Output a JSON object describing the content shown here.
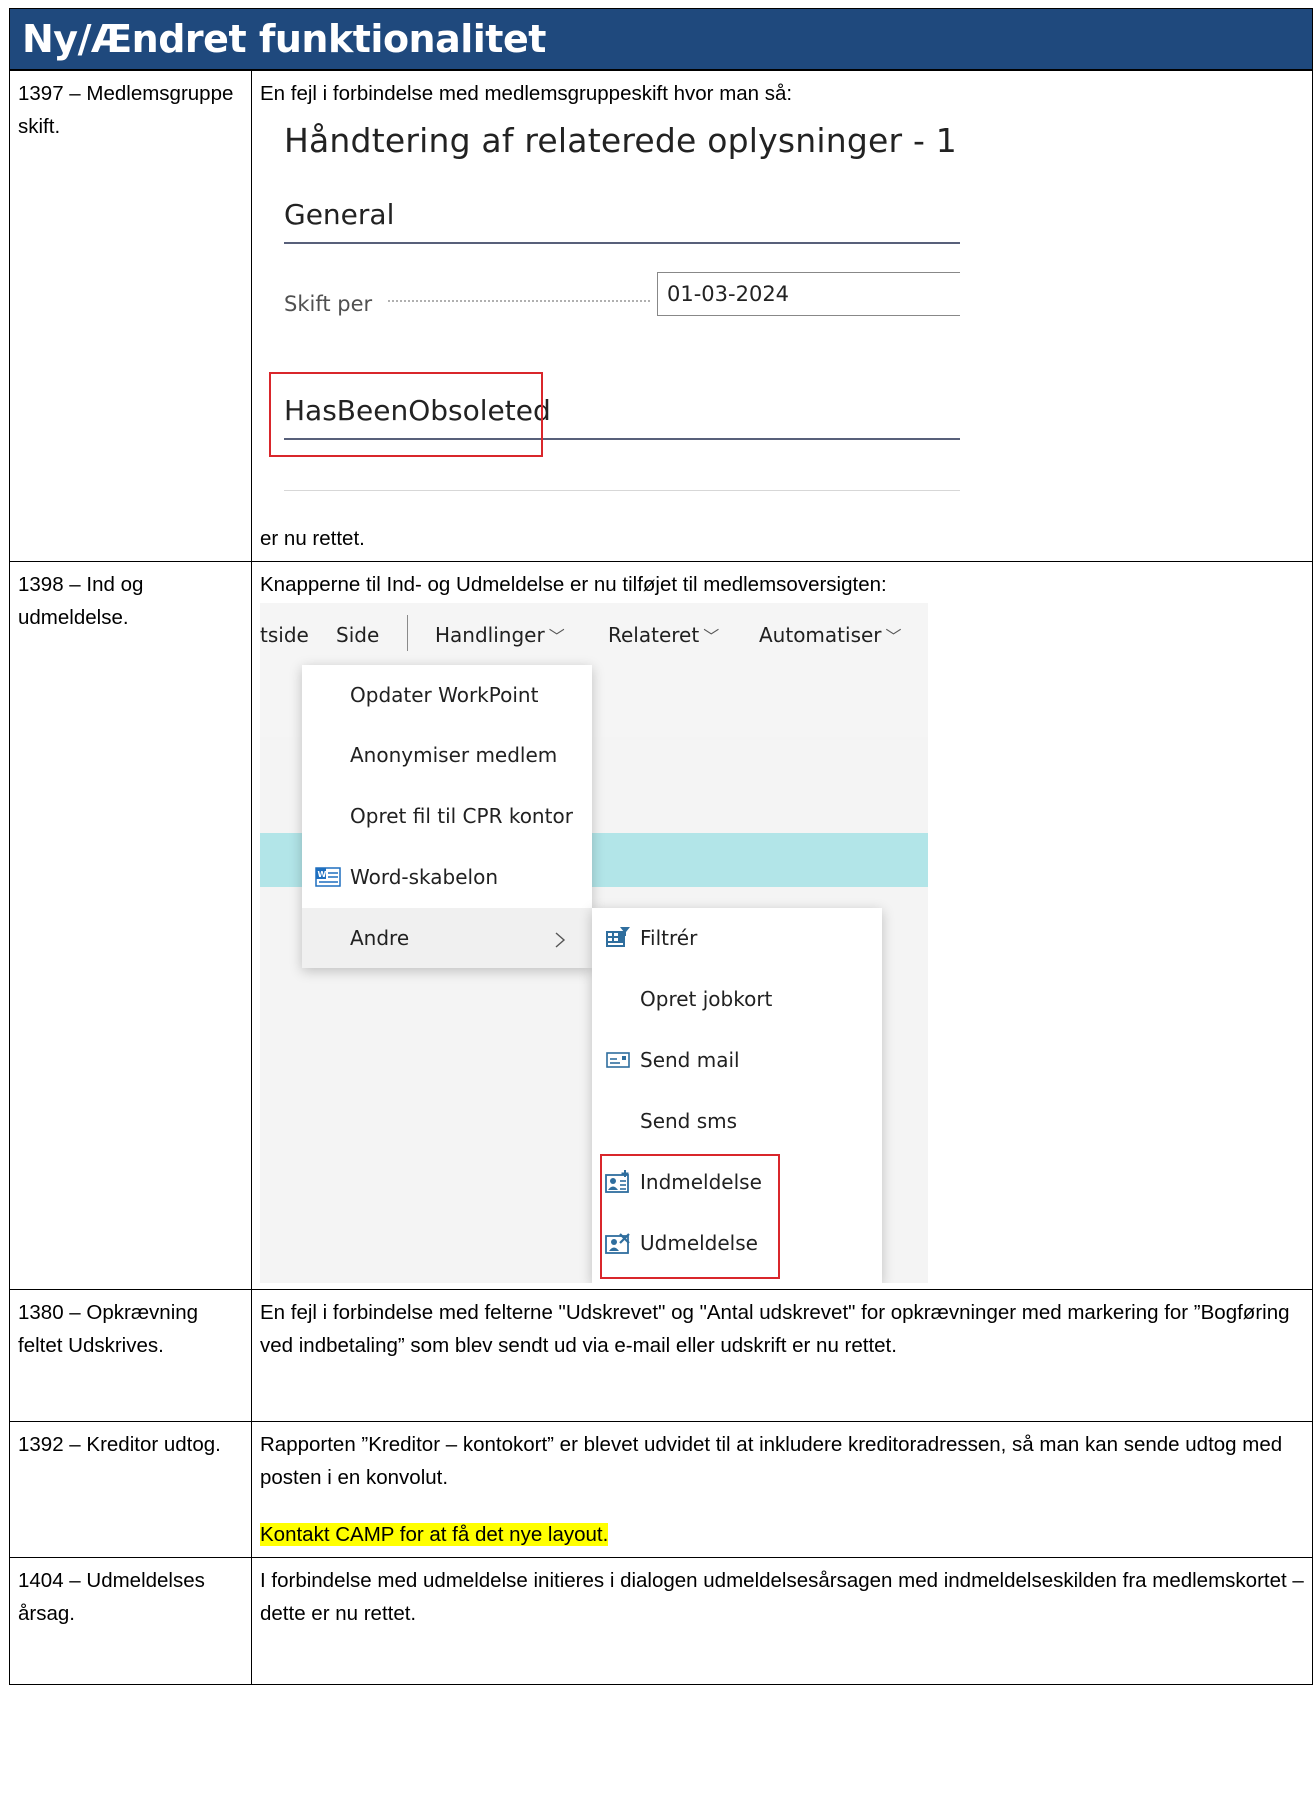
{
  "page_title": "Ny/Ændret funktionalitet",
  "rows": [
    {
      "id": "1397 – Medlemsgruppe skift.",
      "intro": "En fejl i forbindelse med medlemsgruppeskift hvor man så:",
      "screenshot": {
        "dialog_title": "Håndtering af relaterede oplysninger - 1",
        "section_general": "General",
        "field_label": "Skift per",
        "field_value": "01-03-2024",
        "section_obsolete": "HasBeenObsoleted"
      },
      "outro": "er nu rettet."
    },
    {
      "id": "1398 – Ind og udmeldelse.",
      "intro": "Knapperne til Ind- og Udmeldelse er nu tilføjet til medlemsoversigten:",
      "screenshot": {
        "nav": [
          "tside",
          "Side",
          "Handlinger",
          "Relateret",
          "Automatiser"
        ],
        "menu_actions": [
          "Opdater WorkPoint",
          "Anonymiser medlem",
          "Opret fil til CPR kontor",
          "Word-skabelon",
          "Andre"
        ],
        "menu_other": [
          "Filtrér",
          "Opret jobkort",
          "Send mail",
          "Send sms",
          "Indmeldelse",
          "Udmeldelse"
        ],
        "icons": {
          "word_template": "word-template-icon",
          "filter": "filter-icon",
          "send_mail": "mail-icon",
          "enroll": "enroll-member-icon",
          "unenroll": "unenroll-member-icon",
          "chevron": "chevron-right-icon"
        }
      }
    },
    {
      "id": "1380 – Opkrævning feltet Udskrives.",
      "text": "En fejl i forbindelse med felterne \"Udskrevet\" og \"Antal udskrevet\" for opkrævninger med markering for ”Bogføring ved indbetaling” som blev sendt ud via e-mail eller udskrift er nu rettet."
    },
    {
      "id": "1392 – Kreditor udtog.",
      "text": "Rapporten ”Kreditor – kontokort” er blevet udvidet til at inkludere kreditoradressen, så man kan sende udtog med posten i en konvolut.",
      "highlight": "Kontakt CAMP for at få det nye layout."
    },
    {
      "id": "1404 – Udmeldelses årsag.",
      "text": "I forbindelse med udmeldelse initieres i dialogen udmeldelsesårsagen med indmeldelseskilden fra medlemskortet – dette er nu rettet."
    }
  ],
  "colors": {
    "header_bg": "#1f497d",
    "highlight": "#ffff00",
    "callout_red": "#d9262b",
    "selected_row": "#b2e5e8"
  }
}
